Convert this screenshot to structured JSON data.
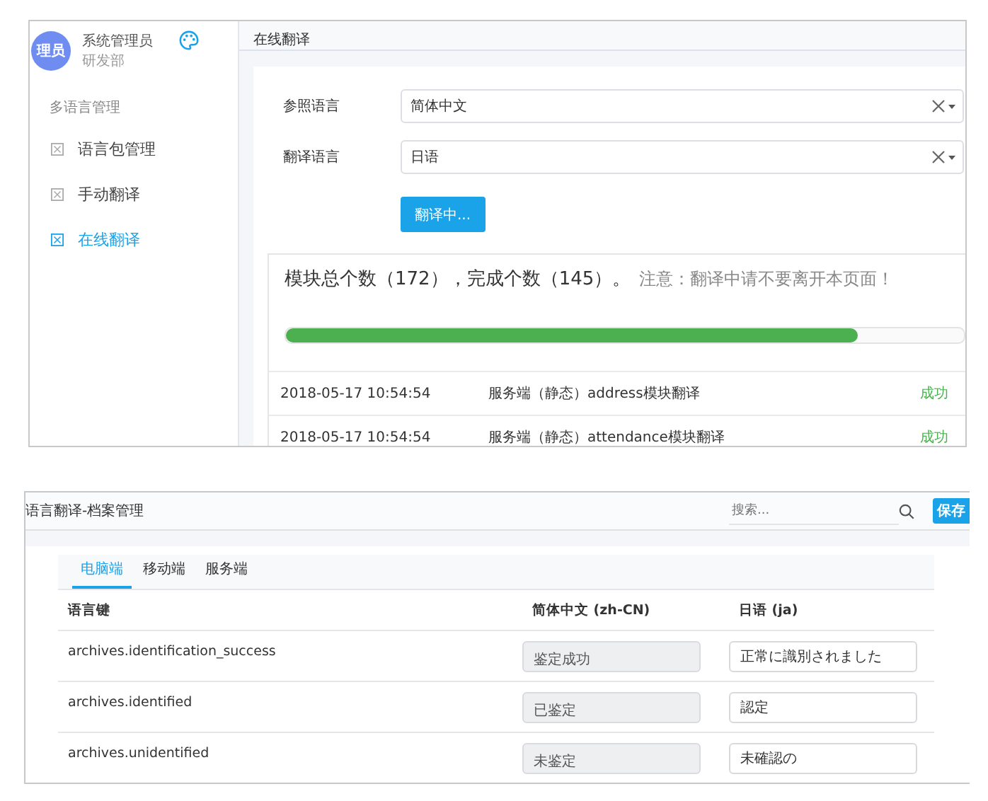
{
  "admin_panel": {
    "user": {
      "avatar_text": "理员",
      "name": "系统管理员",
      "department": "研发部"
    },
    "sidebar": {
      "group": "多语言管理",
      "items": [
        {
          "label": "语言包管理",
          "selected": false
        },
        {
          "label": "手动翻译",
          "selected": false
        },
        {
          "label": "在线翻译",
          "selected": true
        }
      ]
    },
    "header": {
      "title": "在线翻译"
    },
    "form": {
      "fields": [
        {
          "label": "参照语言",
          "value": "简体中文"
        },
        {
          "label": "翻译语言",
          "value": "日语"
        }
      ],
      "button": "翻译中..."
    },
    "progress": {
      "summary": "模块总个数（172），完成个数（145）。",
      "notice": "注意：翻译中请不要离开本页面！",
      "level": 0.843
    },
    "log": [
      {
        "time": "2018-05-17 10:54:54",
        "message": "服务端（静态）address模块翻译",
        "status": "成功"
      },
      {
        "time": "2018-05-17 10:54:54",
        "message": "服务端（静态）attendance模块翻译",
        "status": "成功"
      }
    ]
  },
  "translation_panel": {
    "title": "语言翻译-档案管理",
    "search": {
      "placeholder": "搜索..."
    },
    "save_button": "保存",
    "tabs": [
      {
        "label": "电脑端",
        "selected": true
      },
      {
        "label": "移动端",
        "selected": false
      },
      {
        "label": "服务端",
        "selected": false
      }
    ],
    "table": {
      "columns": [
        "语言键",
        "简体中文 (zh-CN)",
        "日语 (ja)"
      ],
      "rows": [
        {
          "key": "archives.identification_success",
          "reference": "鉴定成功",
          "translation": "正常に識別されました"
        },
        {
          "key": "archives.identified",
          "reference": "已鉴定",
          "translation": "認定"
        },
        {
          "key": "archives.unidentified",
          "reference": "未鉴定",
          "translation": "未確認の"
        }
      ]
    }
  }
}
